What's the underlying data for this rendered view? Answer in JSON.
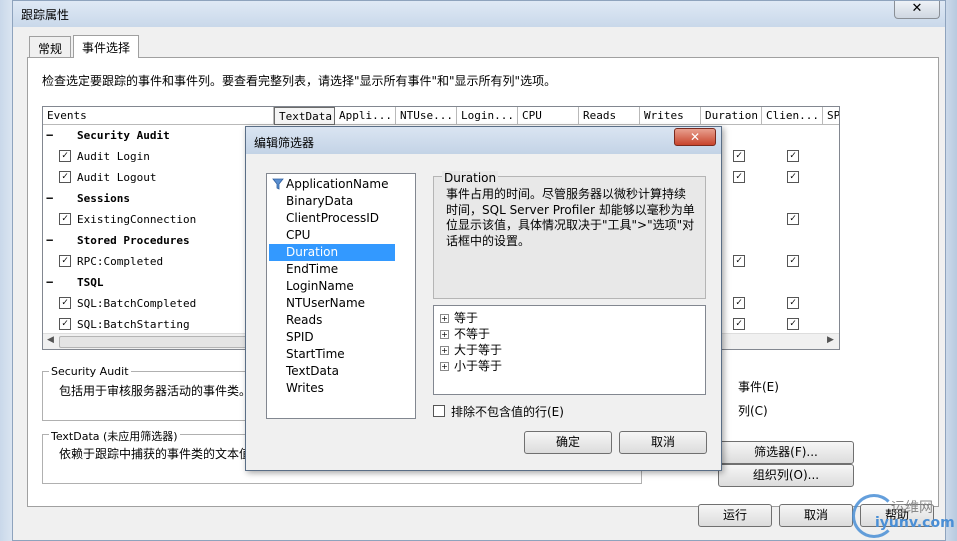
{
  "window": {
    "title": "跟踪属性",
    "close_glyph": "✕"
  },
  "tabs": [
    {
      "label": "常规"
    },
    {
      "label": "事件选择"
    }
  ],
  "instructions": "检查选定要跟踪的事件和事件列。要查看完整列表，请选择\"显示所有事件\"和\"显示所有列\"选项。",
  "grid": {
    "events_header": "Events",
    "columns": [
      "TextData",
      "Appli...",
      "NTUse...",
      "Login...",
      "CPU",
      "Reads",
      "Writes",
      "Duration",
      "Clien...",
      "SP"
    ],
    "categories": [
      {
        "name": "Security Audit",
        "events": [
          "Audit Login",
          "Audit Logout"
        ]
      },
      {
        "name": "Sessions",
        "events": [
          "ExistingConnection"
        ]
      },
      {
        "name": "Stored Procedures",
        "events": [
          "RPC:Completed"
        ]
      },
      {
        "name": "TSQL",
        "events": [
          "SQL:BatchCompleted",
          "SQL:BatchStarting"
        ]
      }
    ],
    "checked_glyph": "✓",
    "minus_glyph": "−"
  },
  "security_group": {
    "legend": "Security Audit",
    "text": "包括用于审核服务器活动的事件类。"
  },
  "textdata_group": {
    "legend": "TextData (未应用筛选器)",
    "text": "依赖于跟踪中捕获的事件类的文本值"
  },
  "right_options": {
    "show_events_tail": "事件(E)",
    "show_columns_tail": "列(C)"
  },
  "buttons": {
    "filters": "筛选器(F)...",
    "organize": "组织列(O)...",
    "run": "运行",
    "cancel": "取消",
    "help": "帮助"
  },
  "filter_dialog": {
    "title": "编辑筛选器",
    "close_glyph": "✕",
    "columns": [
      "ApplicationName",
      "BinaryData",
      "ClientProcessID",
      "CPU",
      "Duration",
      "EndTime",
      "LoginName",
      "NTUserName",
      "Reads",
      "SPID",
      "StartTime",
      "TextData",
      "Writes"
    ],
    "selected_column": "Duration",
    "description_title": "Duration",
    "description": "事件占用的时间。尽管服务器以微秒计算持续时间，SQL Server Profiler 却能够以毫秒为单位显示该值，具体情况取决于\"工具\">\"选项\"对话框中的设置。",
    "operators": [
      "等于",
      "不等于",
      "大于等于",
      "小于等于"
    ],
    "plus_glyph": "+",
    "exclude_label": "排除不包含值的行(E)",
    "ok_label": "确定",
    "cancel_label": "取消"
  },
  "watermark": {
    "line1": "运维网",
    "line2": "iyunv.com"
  }
}
